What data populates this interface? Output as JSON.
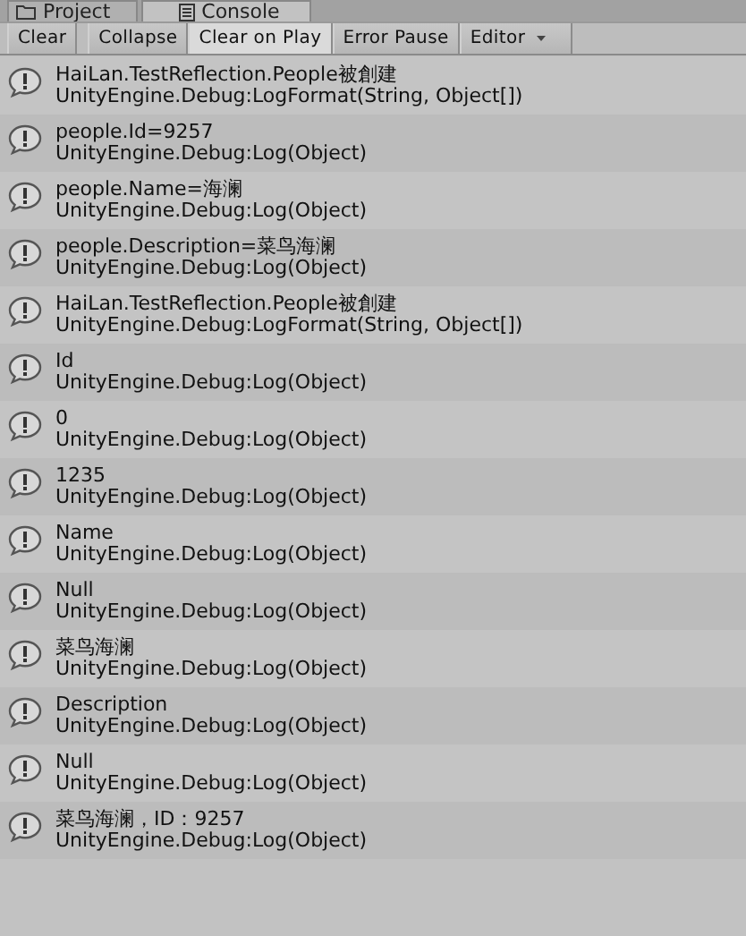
{
  "tabs": [
    {
      "label": "Project",
      "kind": "folder",
      "selected": false
    },
    {
      "label": "Console",
      "kind": "document",
      "selected": true
    }
  ],
  "toolbar": [
    {
      "label": "Clear",
      "selected": false,
      "dropdown": false
    },
    {
      "label": "Collapse",
      "selected": false,
      "dropdown": false
    },
    {
      "label": "Clear on Play",
      "selected": true,
      "dropdown": false
    },
    {
      "label": "Error Pause",
      "selected": false,
      "dropdown": false
    },
    {
      "label": "Editor",
      "selected": false,
      "dropdown": true
    }
  ],
  "log": [
    {
      "message": "HaiLan.TestReflection.People被創建",
      "source": "UnityEngine.Debug:LogFormat(String, Object[])"
    },
    {
      "message": "people.Id=9257",
      "source": "UnityEngine.Debug:Log(Object)"
    },
    {
      "message": "people.Name=海澜",
      "source": "UnityEngine.Debug:Log(Object)"
    },
    {
      "message": "people.Description=菜鸟海澜",
      "source": "UnityEngine.Debug:Log(Object)"
    },
    {
      "message": "HaiLan.TestReflection.People被創建",
      "source": "UnityEngine.Debug:LogFormat(String, Object[])"
    },
    {
      "message": "Id",
      "source": "UnityEngine.Debug:Log(Object)"
    },
    {
      "message": "0",
      "source": "UnityEngine.Debug:Log(Object)"
    },
    {
      "message": "1235",
      "source": "UnityEngine.Debug:Log(Object)"
    },
    {
      "message": "Name",
      "source": "UnityEngine.Debug:Log(Object)"
    },
    {
      "message": "Null",
      "source": "UnityEngine.Debug:Log(Object)"
    },
    {
      "message": "菜鸟海澜",
      "source": "UnityEngine.Debug:Log(Object)"
    },
    {
      "message": "Description",
      "source": "UnityEngine.Debug:Log(Object)"
    },
    {
      "message": "Null",
      "source": "UnityEngine.Debug:Log(Object)"
    },
    {
      "message": "菜鸟海澜，ID：9257",
      "source": "UnityEngine.Debug:Log(Object)"
    }
  ]
}
